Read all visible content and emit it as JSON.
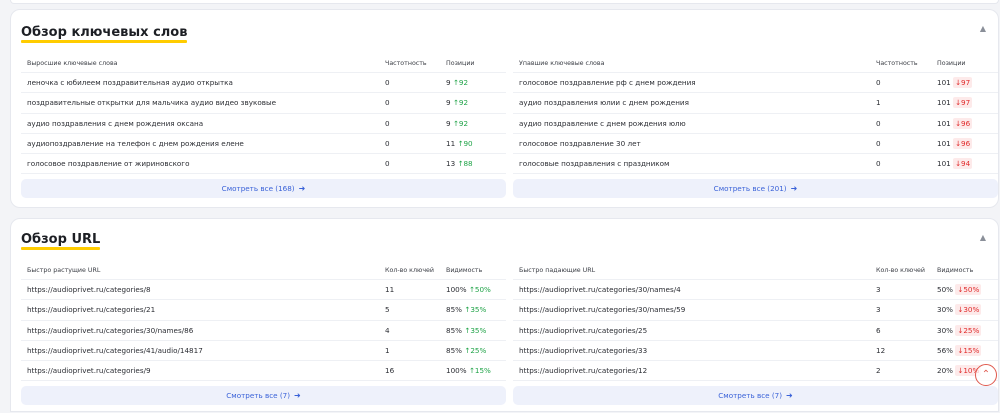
{
  "keywords_section": {
    "title": "Обзор ключевых слов",
    "collapse_icon": "chevron-up-icon",
    "grown": {
      "headers": [
        "Выросшие ключевые слова",
        "Частотность",
        "Позиции"
      ],
      "rows": [
        {
          "keyword": "леночка с юбилеем поздравительная аудио открытка",
          "frequency": "0",
          "position": "9",
          "change": "92"
        },
        {
          "keyword": "поздравительные открытки для мальчика аудио видео звуковые",
          "frequency": "0",
          "position": "9",
          "change": "92"
        },
        {
          "keyword": "аудио поздравления с днем рождения оксана",
          "frequency": "0",
          "position": "9",
          "change": "92"
        },
        {
          "keyword": "аудиопоздравление на телефон с днем рождения елене",
          "frequency": "0",
          "position": "11",
          "change": "90"
        },
        {
          "keyword": "голосовое поздравление от жириновского",
          "frequency": "0",
          "position": "13",
          "change": "88"
        }
      ],
      "show_all": "Смотреть все (168)"
    },
    "fallen": {
      "headers": [
        "Упавшие ключевые слова",
        "Частотность",
        "Позиции"
      ],
      "rows": [
        {
          "keyword": "голосовое поздравление рф с днем рождения",
          "frequency": "0",
          "position": "101",
          "change": "97"
        },
        {
          "keyword": "аудио поздравления юлии с днем рождения",
          "frequency": "1",
          "position": "101",
          "change": "97"
        },
        {
          "keyword": "аудио поздравление с днем рождения юлю",
          "frequency": "0",
          "position": "101",
          "change": "96"
        },
        {
          "keyword": "голосовое поздравление 30 лет",
          "frequency": "0",
          "position": "101",
          "change": "96"
        },
        {
          "keyword": "голосовые поздравления с праздником",
          "frequency": "0",
          "position": "101",
          "change": "94"
        }
      ],
      "show_all": "Смотреть все (201)"
    }
  },
  "url_section": {
    "title": "Обзор URL",
    "collapse_icon": "chevron-up-icon",
    "growing": {
      "headers": [
        "Быстро растущие URL",
        "Кол-во ключей",
        "Видимость"
      ],
      "rows": [
        {
          "url": "https://audioprivet.ru/categories/8",
          "keys": "11",
          "visibility": "100%",
          "change": "50%"
        },
        {
          "url": "https://audioprivet.ru/categories/21",
          "keys": "5",
          "visibility": "85%",
          "change": "35%"
        },
        {
          "url": "https://audioprivet.ru/categories/30/names/86",
          "keys": "4",
          "visibility": "85%",
          "change": "35%"
        },
        {
          "url": "https://audioprivet.ru/categories/41/audio/14817",
          "keys": "1",
          "visibility": "85%",
          "change": "25%"
        },
        {
          "url": "https://audioprivet.ru/categories/9",
          "keys": "16",
          "visibility": "100%",
          "change": "15%"
        }
      ],
      "show_all": "Смотреть все (7)"
    },
    "falling": {
      "headers": [
        "Быстро падающие URL",
        "Кол-во ключей",
        "Видимость"
      ],
      "rows": [
        {
          "url": "https://audioprivet.ru/categories/30/names/4",
          "keys": "3",
          "visibility": "50%",
          "change": "50%"
        },
        {
          "url": "https://audioprivet.ru/categories/30/names/59",
          "keys": "3",
          "visibility": "30%",
          "change": "30%"
        },
        {
          "url": "https://audioprivet.ru/categories/25",
          "keys": "6",
          "visibility": "30%",
          "change": "25%"
        },
        {
          "url": "https://audioprivet.ru/categories/33",
          "keys": "12",
          "visibility": "56%",
          "change": "15%"
        },
        {
          "url": "https://audioprivet.ru/categories/12",
          "keys": "2",
          "visibility": "20%",
          "change": "10%"
        }
      ],
      "show_all": "Смотреть все (7)"
    }
  },
  "icons": {
    "up": "arrow-up-icon",
    "down": "arrow-down-icon",
    "more": "arrow-right-icon",
    "scroll_top": "chevron-up-circle-icon"
  },
  "colors": {
    "accent": "#3a62d8",
    "up": "#1fa347",
    "down": "#e02b2b",
    "title_underline": "#ffcc00",
    "scroll_button": "#e05a4f"
  }
}
